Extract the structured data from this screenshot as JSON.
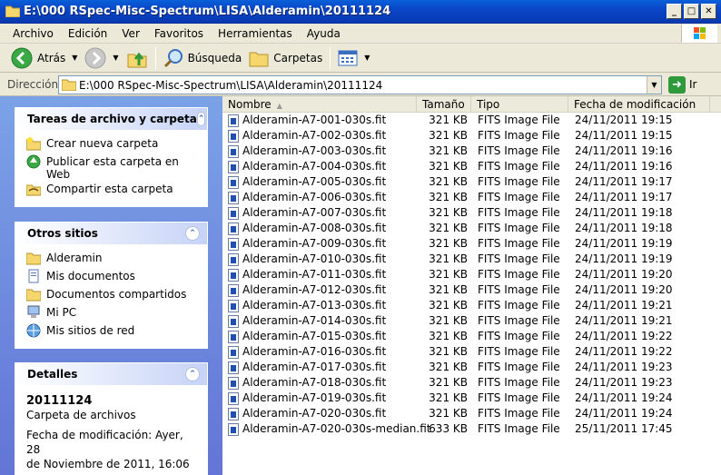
{
  "window": {
    "title": "E:\\000 RSpec-Misc-Spectrum\\LISA\\Alderamin\\20111124",
    "buttons": {
      "minimize": "_",
      "maximize": "□",
      "close": "✕"
    }
  },
  "menu": [
    {
      "label": "Archivo"
    },
    {
      "label": "Edición"
    },
    {
      "label": "Ver"
    },
    {
      "label": "Favoritos"
    },
    {
      "label": "Herramientas"
    },
    {
      "label": "Ayuda"
    }
  ],
  "toolbar": {
    "back_label": "Atrás",
    "search_label": "Búsqueda",
    "folders_label": "Carpetas"
  },
  "address": {
    "label": "Dirección",
    "value": "E:\\000 RSpec-Misc-Spectrum\\LISA\\Alderamin\\20111124",
    "go_label": "Ir"
  },
  "tasks_panel": {
    "title": "Tareas de archivo y carpeta",
    "items": [
      {
        "label": "Crear nueva carpeta",
        "icon": "new-folder-icon"
      },
      {
        "label": "Publicar esta carpeta en Web",
        "icon": "publish-web-icon"
      },
      {
        "label": "Compartir esta carpeta",
        "icon": "share-folder-icon"
      }
    ]
  },
  "places_panel": {
    "title": "Otros sitios",
    "items": [
      {
        "label": "Alderamin",
        "icon": "folder-icon"
      },
      {
        "label": "Mis documentos",
        "icon": "documents-icon"
      },
      {
        "label": "Documentos compartidos",
        "icon": "folder-icon"
      },
      {
        "label": "Mi PC",
        "icon": "computer-icon"
      },
      {
        "label": "Mis sitios de red",
        "icon": "network-icon"
      }
    ]
  },
  "details_panel": {
    "title": "Detalles",
    "name": "20111124",
    "type": "Carpeta de archivos",
    "modified_line1": "Fecha de modificación: Ayer, 28",
    "modified_line2": "de Noviembre de 2011, 16:06"
  },
  "columns": {
    "name": "Nombre",
    "size": "Tamaño",
    "type": "Tipo",
    "date": "Fecha de modificación"
  },
  "files": [
    {
      "name": "Alderamin-A7-001-030s.fit",
      "size": "321 KB",
      "type": "FITS Image File",
      "date": "24/11/2011 19:15"
    },
    {
      "name": "Alderamin-A7-002-030s.fit",
      "size": "321 KB",
      "type": "FITS Image File",
      "date": "24/11/2011 19:15"
    },
    {
      "name": "Alderamin-A7-003-030s.fit",
      "size": "321 KB",
      "type": "FITS Image File",
      "date": "24/11/2011 19:16"
    },
    {
      "name": "Alderamin-A7-004-030s.fit",
      "size": "321 KB",
      "type": "FITS Image File",
      "date": "24/11/2011 19:16"
    },
    {
      "name": "Alderamin-A7-005-030s.fit",
      "size": "321 KB",
      "type": "FITS Image File",
      "date": "24/11/2011 19:17"
    },
    {
      "name": "Alderamin-A7-006-030s.fit",
      "size": "321 KB",
      "type": "FITS Image File",
      "date": "24/11/2011 19:17"
    },
    {
      "name": "Alderamin-A7-007-030s.fit",
      "size": "321 KB",
      "type": "FITS Image File",
      "date": "24/11/2011 19:18"
    },
    {
      "name": "Alderamin-A7-008-030s.fit",
      "size": "321 KB",
      "type": "FITS Image File",
      "date": "24/11/2011 19:18"
    },
    {
      "name": "Alderamin-A7-009-030s.fit",
      "size": "321 KB",
      "type": "FITS Image File",
      "date": "24/11/2011 19:19"
    },
    {
      "name": "Alderamin-A7-010-030s.fit",
      "size": "321 KB",
      "type": "FITS Image File",
      "date": "24/11/2011 19:19"
    },
    {
      "name": "Alderamin-A7-011-030s.fit",
      "size": "321 KB",
      "type": "FITS Image File",
      "date": "24/11/2011 19:20"
    },
    {
      "name": "Alderamin-A7-012-030s.fit",
      "size": "321 KB",
      "type": "FITS Image File",
      "date": "24/11/2011 19:20"
    },
    {
      "name": "Alderamin-A7-013-030s.fit",
      "size": "321 KB",
      "type": "FITS Image File",
      "date": "24/11/2011 19:21"
    },
    {
      "name": "Alderamin-A7-014-030s.fit",
      "size": "321 KB",
      "type": "FITS Image File",
      "date": "24/11/2011 19:21"
    },
    {
      "name": "Alderamin-A7-015-030s.fit",
      "size": "321 KB",
      "type": "FITS Image File",
      "date": "24/11/2011 19:22"
    },
    {
      "name": "Alderamin-A7-016-030s.fit",
      "size": "321 KB",
      "type": "FITS Image File",
      "date": "24/11/2011 19:22"
    },
    {
      "name": "Alderamin-A7-017-030s.fit",
      "size": "321 KB",
      "type": "FITS Image File",
      "date": "24/11/2011 19:23"
    },
    {
      "name": "Alderamin-A7-018-030s.fit",
      "size": "321 KB",
      "type": "FITS Image File",
      "date": "24/11/2011 19:23"
    },
    {
      "name": "Alderamin-A7-019-030s.fit",
      "size": "321 KB",
      "type": "FITS Image File",
      "date": "24/11/2011 19:24"
    },
    {
      "name": "Alderamin-A7-020-030s.fit",
      "size": "321 KB",
      "type": "FITS Image File",
      "date": "24/11/2011 19:24"
    },
    {
      "name": "Alderamin-A7-020-030s-median.fit",
      "size": "633 KB",
      "type": "FITS Image File",
      "date": "25/11/2011 17:45"
    }
  ]
}
